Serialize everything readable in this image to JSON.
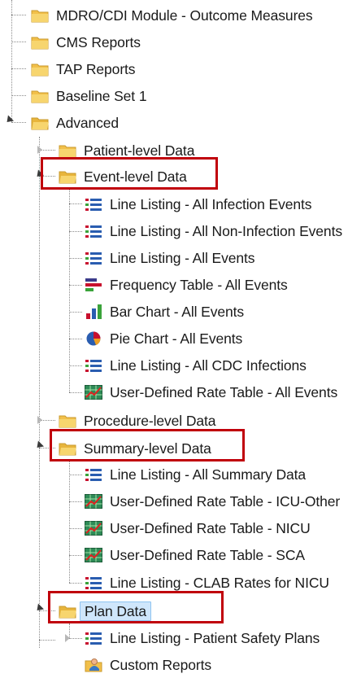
{
  "tree": {
    "top_items": [
      {
        "label": "MDRO/CDI Module - Outcome Measures",
        "icon": "folder-icon"
      },
      {
        "label": "CMS Reports",
        "icon": "folder-icon"
      },
      {
        "label": "TAP Reports",
        "icon": "folder-icon"
      },
      {
        "label": "Baseline Set 1",
        "icon": "folder-icon"
      },
      {
        "label": "Advanced",
        "icon": "folder-open-icon"
      }
    ],
    "advanced": {
      "patient_level": {
        "label": "Patient-level Data"
      },
      "event_level": {
        "label": "Event-level Data",
        "items": [
          {
            "label": "Line Listing - All Infection Events",
            "icon": "line-listing-icon"
          },
          {
            "label": "Line Listing - All Non-Infection Events",
            "icon": "line-listing-icon"
          },
          {
            "label": "Line Listing - All Events",
            "icon": "line-listing-icon"
          },
          {
            "label": "Frequency Table - All Events",
            "icon": "frequency-table-icon"
          },
          {
            "label": "Bar Chart - All Events",
            "icon": "bar-chart-icon"
          },
          {
            "label": "Pie Chart - All Events",
            "icon": "pie-chart-icon"
          },
          {
            "label": "Line Listing - All CDC Infections",
            "icon": "line-listing-icon"
          },
          {
            "label": "User-Defined Rate Table - All Events",
            "icon": "rate-table-icon"
          }
        ]
      },
      "procedure_level": {
        "label": "Procedure-level Data"
      },
      "summary_level": {
        "label": "Summary-level Data",
        "items": [
          {
            "label": "Line Listing - All Summary Data",
            "icon": "line-listing-icon"
          },
          {
            "label": "User-Defined Rate Table - ICU-Other",
            "icon": "rate-table-icon"
          },
          {
            "label": "User-Defined Rate Table - NICU",
            "icon": "rate-table-icon"
          },
          {
            "label": "User-Defined Rate Table - SCA",
            "icon": "rate-table-icon"
          },
          {
            "label": "Line Listing - CLAB Rates for NICU",
            "icon": "line-listing-icon"
          }
        ]
      },
      "plan_data": {
        "label": "Plan Data",
        "items": [
          {
            "label": "Line Listing - Patient Safety Plans",
            "icon": "line-listing-icon"
          }
        ]
      }
    },
    "custom_reports": {
      "label": "Custom Reports",
      "icon": "custom-reports-icon"
    }
  },
  "highlight_color": "#c0000b",
  "folder_color": "#f2c04a"
}
